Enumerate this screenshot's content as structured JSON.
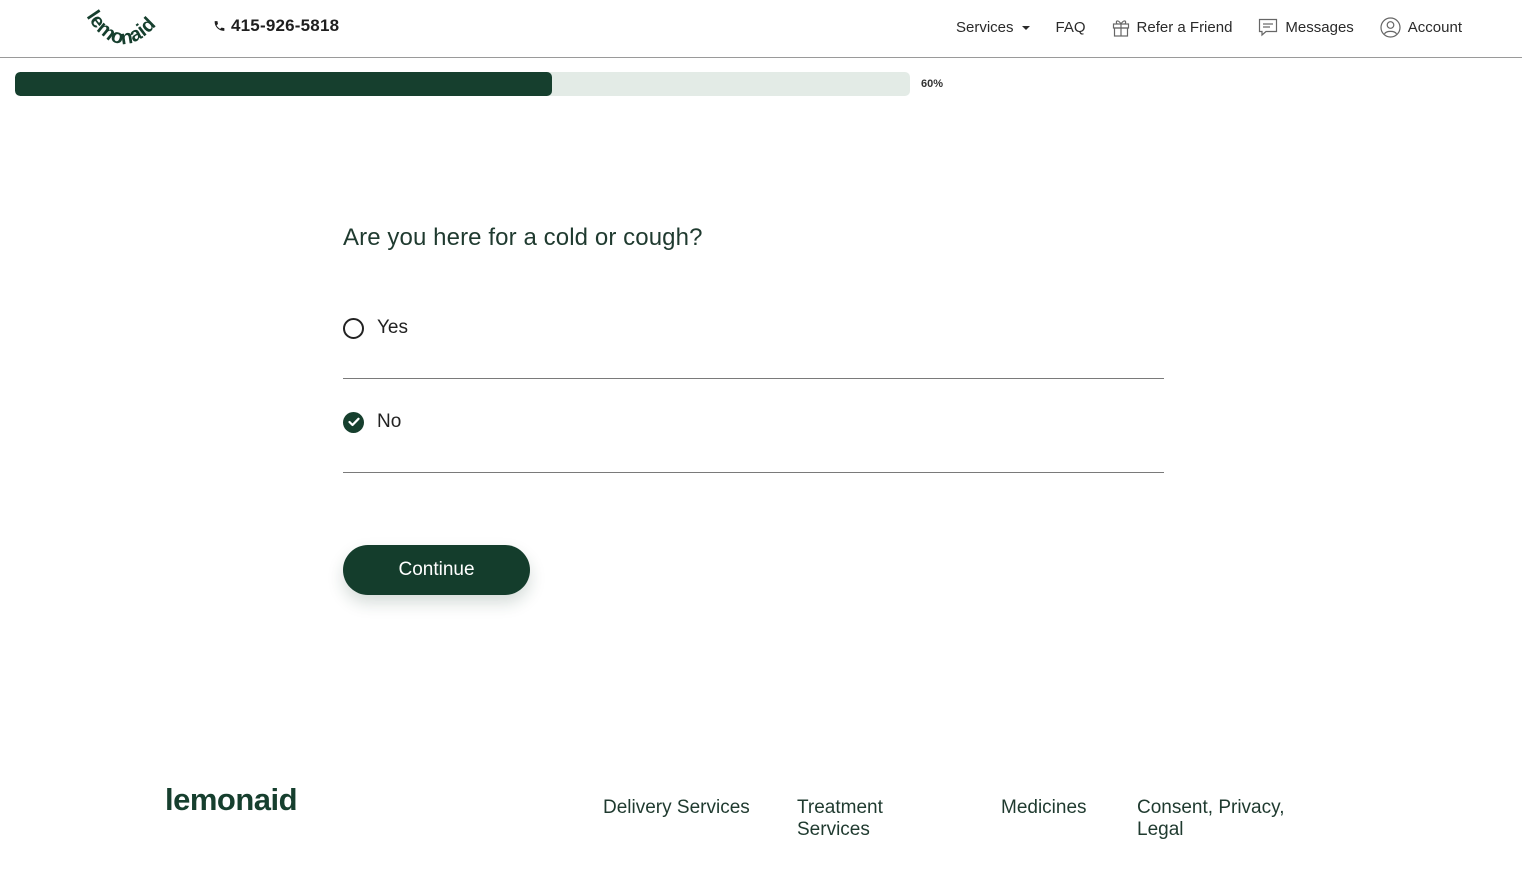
{
  "header": {
    "logo_text": "lemonaid",
    "phone": "415-926-5818",
    "nav": {
      "services": "Services",
      "faq": "FAQ",
      "refer": "Refer a Friend",
      "messages": "Messages",
      "account": "Account"
    }
  },
  "progress": {
    "value": 0.6,
    "label": "60%"
  },
  "question": {
    "title": "Are you here for a cold or cough?",
    "options": [
      {
        "label": "Yes",
        "selected": false
      },
      {
        "label": "No",
        "selected": true
      }
    ]
  },
  "actions": {
    "continue_label": "Continue"
  },
  "footer": {
    "logo_text": "lemonaid",
    "links": {
      "delivery": "Delivery Services",
      "treatment": "Treatment Services",
      "medicines": "Medicines",
      "legal": "Consent, Privacy, Legal"
    }
  },
  "colors": {
    "brand_green": "#163f2e",
    "progress_track": "#e3ebe6"
  },
  "icons": {
    "phone": "phone-icon",
    "gift": "gift-icon",
    "message": "message-icon",
    "account": "user-circle-icon",
    "check": "check-icon"
  }
}
